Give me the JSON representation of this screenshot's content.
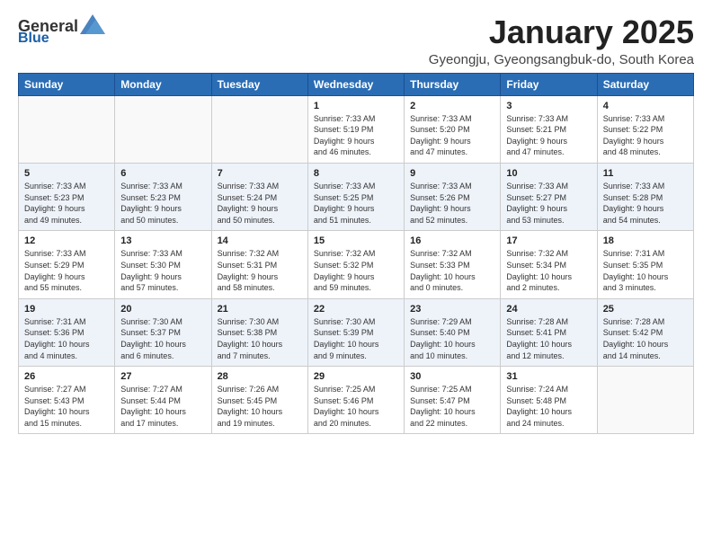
{
  "header": {
    "logo_general": "General",
    "logo_blue": "Blue",
    "title": "January 2025",
    "subtitle": "Gyeongju, Gyeongsangbuk-do, South Korea"
  },
  "weekdays": [
    "Sunday",
    "Monday",
    "Tuesday",
    "Wednesday",
    "Thursday",
    "Friday",
    "Saturday"
  ],
  "weeks": [
    [
      {
        "day": "",
        "info": ""
      },
      {
        "day": "",
        "info": ""
      },
      {
        "day": "",
        "info": ""
      },
      {
        "day": "1",
        "info": "Sunrise: 7:33 AM\nSunset: 5:19 PM\nDaylight: 9 hours\nand 46 minutes."
      },
      {
        "day": "2",
        "info": "Sunrise: 7:33 AM\nSunset: 5:20 PM\nDaylight: 9 hours\nand 47 minutes."
      },
      {
        "day": "3",
        "info": "Sunrise: 7:33 AM\nSunset: 5:21 PM\nDaylight: 9 hours\nand 47 minutes."
      },
      {
        "day": "4",
        "info": "Sunrise: 7:33 AM\nSunset: 5:22 PM\nDaylight: 9 hours\nand 48 minutes."
      }
    ],
    [
      {
        "day": "5",
        "info": "Sunrise: 7:33 AM\nSunset: 5:23 PM\nDaylight: 9 hours\nand 49 minutes."
      },
      {
        "day": "6",
        "info": "Sunrise: 7:33 AM\nSunset: 5:23 PM\nDaylight: 9 hours\nand 50 minutes."
      },
      {
        "day": "7",
        "info": "Sunrise: 7:33 AM\nSunset: 5:24 PM\nDaylight: 9 hours\nand 50 minutes."
      },
      {
        "day": "8",
        "info": "Sunrise: 7:33 AM\nSunset: 5:25 PM\nDaylight: 9 hours\nand 51 minutes."
      },
      {
        "day": "9",
        "info": "Sunrise: 7:33 AM\nSunset: 5:26 PM\nDaylight: 9 hours\nand 52 minutes."
      },
      {
        "day": "10",
        "info": "Sunrise: 7:33 AM\nSunset: 5:27 PM\nDaylight: 9 hours\nand 53 minutes."
      },
      {
        "day": "11",
        "info": "Sunrise: 7:33 AM\nSunset: 5:28 PM\nDaylight: 9 hours\nand 54 minutes."
      }
    ],
    [
      {
        "day": "12",
        "info": "Sunrise: 7:33 AM\nSunset: 5:29 PM\nDaylight: 9 hours\nand 55 minutes."
      },
      {
        "day": "13",
        "info": "Sunrise: 7:33 AM\nSunset: 5:30 PM\nDaylight: 9 hours\nand 57 minutes."
      },
      {
        "day": "14",
        "info": "Sunrise: 7:32 AM\nSunset: 5:31 PM\nDaylight: 9 hours\nand 58 minutes."
      },
      {
        "day": "15",
        "info": "Sunrise: 7:32 AM\nSunset: 5:32 PM\nDaylight: 9 hours\nand 59 minutes."
      },
      {
        "day": "16",
        "info": "Sunrise: 7:32 AM\nSunset: 5:33 PM\nDaylight: 10 hours\nand 0 minutes."
      },
      {
        "day": "17",
        "info": "Sunrise: 7:32 AM\nSunset: 5:34 PM\nDaylight: 10 hours\nand 2 minutes."
      },
      {
        "day": "18",
        "info": "Sunrise: 7:31 AM\nSunset: 5:35 PM\nDaylight: 10 hours\nand 3 minutes."
      }
    ],
    [
      {
        "day": "19",
        "info": "Sunrise: 7:31 AM\nSunset: 5:36 PM\nDaylight: 10 hours\nand 4 minutes."
      },
      {
        "day": "20",
        "info": "Sunrise: 7:30 AM\nSunset: 5:37 PM\nDaylight: 10 hours\nand 6 minutes."
      },
      {
        "day": "21",
        "info": "Sunrise: 7:30 AM\nSunset: 5:38 PM\nDaylight: 10 hours\nand 7 minutes."
      },
      {
        "day": "22",
        "info": "Sunrise: 7:30 AM\nSunset: 5:39 PM\nDaylight: 10 hours\nand 9 minutes."
      },
      {
        "day": "23",
        "info": "Sunrise: 7:29 AM\nSunset: 5:40 PM\nDaylight: 10 hours\nand 10 minutes."
      },
      {
        "day": "24",
        "info": "Sunrise: 7:28 AM\nSunset: 5:41 PM\nDaylight: 10 hours\nand 12 minutes."
      },
      {
        "day": "25",
        "info": "Sunrise: 7:28 AM\nSunset: 5:42 PM\nDaylight: 10 hours\nand 14 minutes."
      }
    ],
    [
      {
        "day": "26",
        "info": "Sunrise: 7:27 AM\nSunset: 5:43 PM\nDaylight: 10 hours\nand 15 minutes."
      },
      {
        "day": "27",
        "info": "Sunrise: 7:27 AM\nSunset: 5:44 PM\nDaylight: 10 hours\nand 17 minutes."
      },
      {
        "day": "28",
        "info": "Sunrise: 7:26 AM\nSunset: 5:45 PM\nDaylight: 10 hours\nand 19 minutes."
      },
      {
        "day": "29",
        "info": "Sunrise: 7:25 AM\nSunset: 5:46 PM\nDaylight: 10 hours\nand 20 minutes."
      },
      {
        "day": "30",
        "info": "Sunrise: 7:25 AM\nSunset: 5:47 PM\nDaylight: 10 hours\nand 22 minutes."
      },
      {
        "day": "31",
        "info": "Sunrise: 7:24 AM\nSunset: 5:48 PM\nDaylight: 10 hours\nand 24 minutes."
      },
      {
        "day": "",
        "info": ""
      }
    ]
  ]
}
